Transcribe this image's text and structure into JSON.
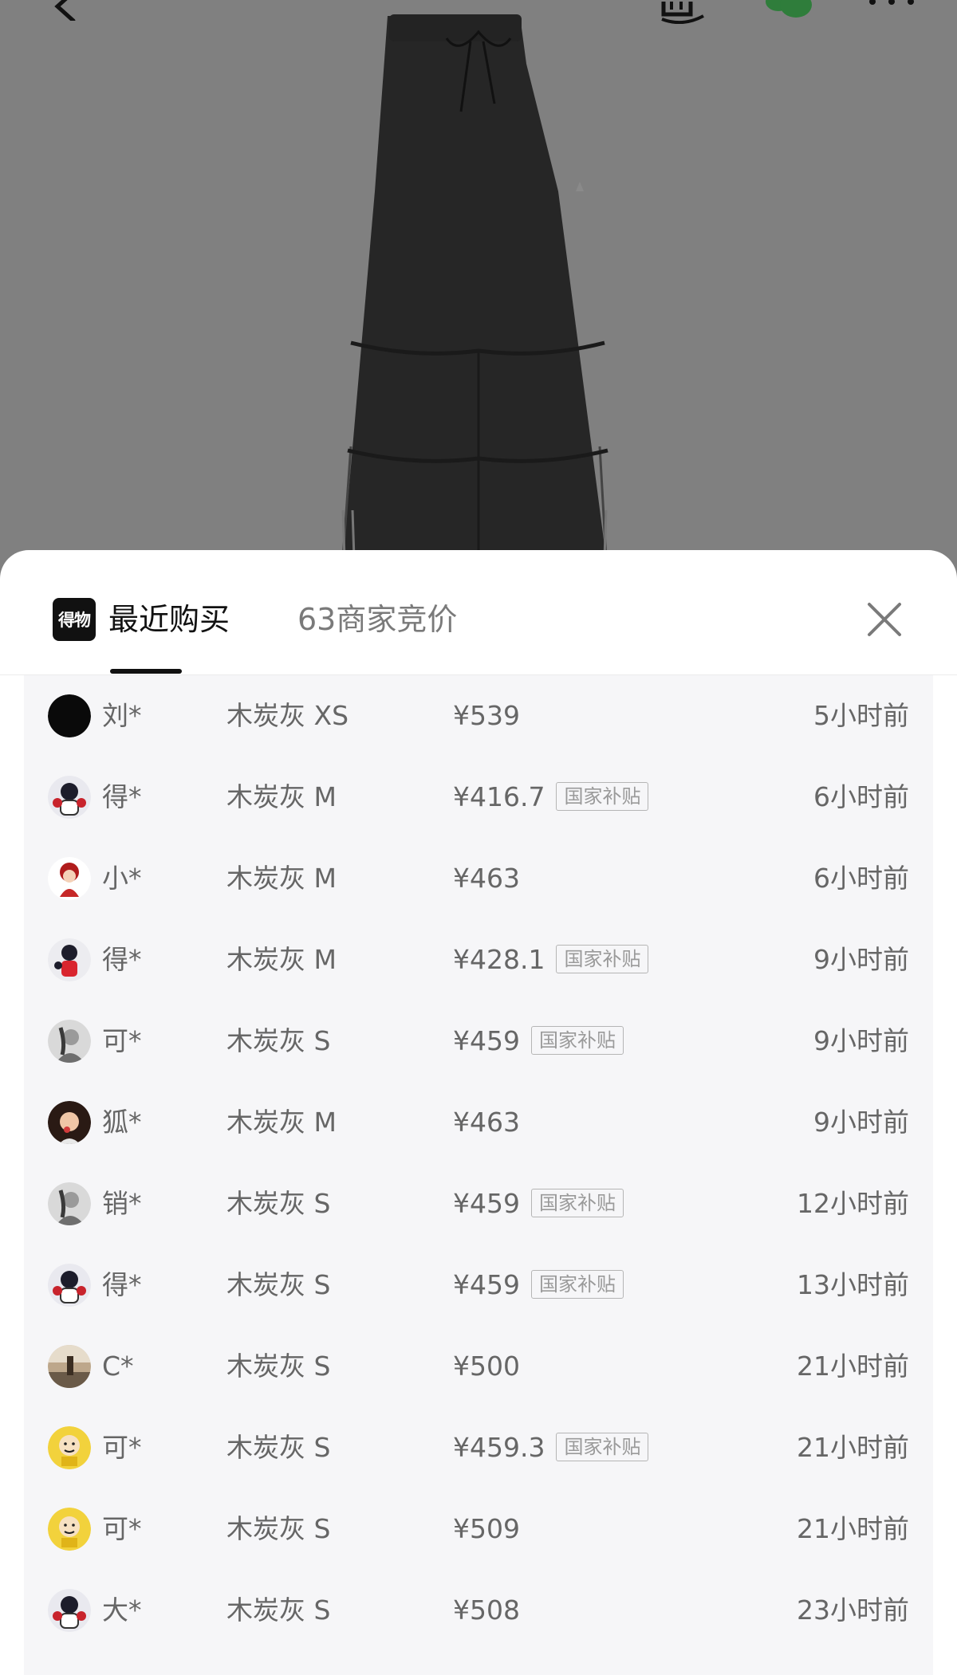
{
  "colors": {
    "dim_background": "#808080",
    "sheet_background": "#ffffff",
    "list_background": "#f6f6f8",
    "active_tab": "#111111",
    "inactive_tab": "#7a7a7a",
    "row_text": "#666666",
    "badge_border": "#b5b5b5",
    "wechat_green": "#2f7d3b"
  },
  "top_bar": {
    "icons": [
      "back-arrow-icon",
      "brand-mark-icon",
      "wechat-share-icon",
      "more-icon"
    ]
  },
  "product": {
    "image": "black-wide-leg-pants-photo"
  },
  "sheet": {
    "brand_logo_text": "得物",
    "tabs": [
      {
        "label": "最近购买",
        "active": true
      },
      {
        "label": "63商家竞价",
        "active": false
      }
    ],
    "close_icon": "close-icon"
  },
  "purchases": [
    {
      "name": "刘*",
      "variant": "木炭灰 XS",
      "price": "¥539",
      "badge": "",
      "time": "5小时前",
      "avatar": "black-circle"
    },
    {
      "name": "得*",
      "variant": "木炭灰 M",
      "price": "¥416.7",
      "badge": "国家补贴",
      "time": "6小时前",
      "avatar": "cartoon-character"
    },
    {
      "name": "小*",
      "variant": "木炭灰 M",
      "price": "¥463",
      "badge": "",
      "time": "6小时前",
      "avatar": "cartoon-girl-red"
    },
    {
      "name": "得*",
      "variant": "木炭灰 M",
      "price": "¥428.1",
      "badge": "国家补贴",
      "time": "9小时前",
      "avatar": "cartoon-character-red"
    },
    {
      "name": "可*",
      "variant": "木炭灰 S",
      "price": "¥459",
      "badge": "国家补贴",
      "time": "9小时前",
      "avatar": "portrait-gray"
    },
    {
      "name": "狐*",
      "variant": "木炭灰 M",
      "price": "¥463",
      "badge": "",
      "time": "9小时前",
      "avatar": "portrait-color"
    },
    {
      "name": "销*",
      "variant": "木炭灰 S",
      "price": "¥459",
      "badge": "国家补贴",
      "time": "12小时前",
      "avatar": "portrait-gray"
    },
    {
      "name": "得*",
      "variant": "木炭灰 S",
      "price": "¥459",
      "badge": "国家补贴",
      "time": "13小时前",
      "avatar": "cartoon-character"
    },
    {
      "name": "C*",
      "variant": "木炭灰 S",
      "price": "¥500",
      "badge": "",
      "time": "21小时前",
      "avatar": "landscape-photo"
    },
    {
      "name": "可*",
      "variant": "木炭灰 S",
      "price": "¥459.3",
      "badge": "国家补贴",
      "time": "21小时前",
      "avatar": "yellow-cartoon"
    },
    {
      "name": "可*",
      "variant": "木炭灰 S",
      "price": "¥509",
      "badge": "",
      "time": "21小时前",
      "avatar": "yellow-cartoon"
    },
    {
      "name": "大*",
      "variant": "木炭灰 S",
      "price": "¥508",
      "badge": "",
      "time": "23小时前",
      "avatar": "cartoon-character"
    }
  ]
}
